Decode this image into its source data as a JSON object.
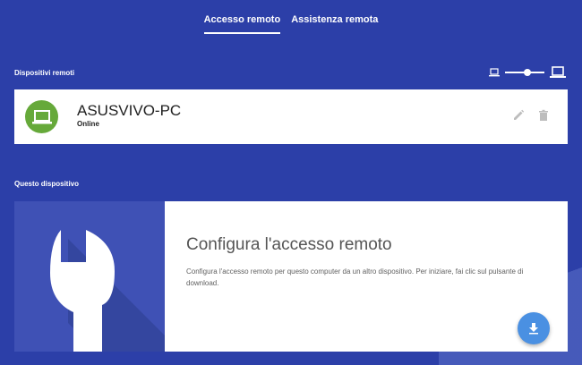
{
  "nav": {
    "tabs": [
      {
        "label": "Accesso remoto",
        "active": true
      },
      {
        "label": "Assistenza remota",
        "active": false
      }
    ]
  },
  "remote_devices": {
    "section_label": "Dispositivi remoti",
    "size_slider_level": 0.5,
    "devices": [
      {
        "name": "ASUSVIVO-PC",
        "status": "Online",
        "icon": "laptop-icon",
        "avatar_color": "#66a93a"
      }
    ],
    "actions": [
      "edit-icon",
      "delete-icon"
    ]
  },
  "this_device": {
    "section_label": "Questo dispositivo",
    "title": "Configura l'accesso remoto",
    "description": "Configura l'accesso remoto per questo computer da un altro dispositivo. Per iniziare, fai clic sul pulsante di download.",
    "hero_icon": "wrench-icon",
    "download_icon": "download-icon"
  },
  "colors": {
    "background": "#2c3fa8",
    "hero": "#3f51b5",
    "fab": "#4a90e2",
    "avatar": "#66a93a"
  }
}
